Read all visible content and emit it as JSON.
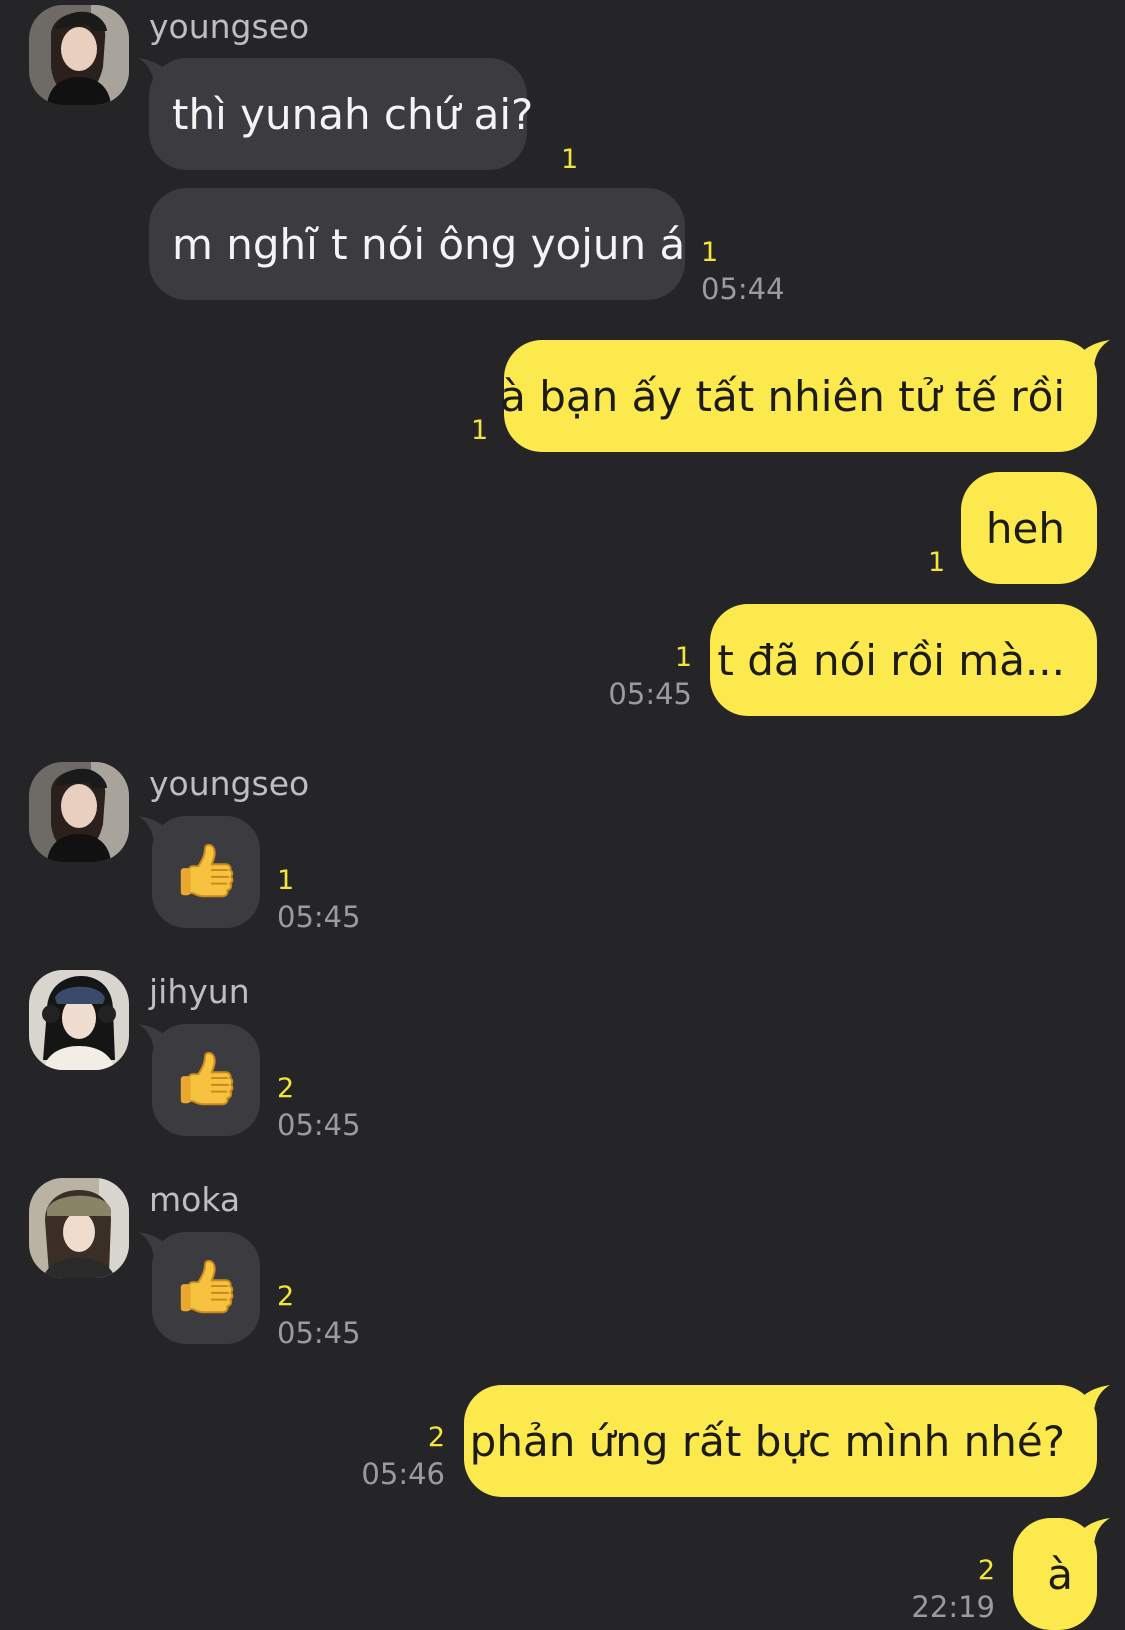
{
  "colors": {
    "background": "#252528",
    "incoming_bubble": "#3c3c40",
    "outgoing_bubble": "#fbe94e",
    "unread_count": "#f4e43e",
    "timestamp": "#9a9aa0",
    "sender_name": "#bdbdc2"
  },
  "messages": [
    {
      "sender": "youngseo",
      "avatar": "avatar-photo-icon",
      "text": "thì yunah chứ ai?",
      "unread": "1"
    },
    {
      "text": "m nghĩ t nói ông yojun á",
      "unread": "1",
      "time": "05:44"
    },
    {
      "text": "à bạn ấy tất nhiên tử tế rồi",
      "unread": "1"
    },
    {
      "text": "heh",
      "unread": "1"
    },
    {
      "text": "t đã nói rồi mà...",
      "unread": "1",
      "time": "05:45"
    },
    {
      "sender": "youngseo",
      "avatar": "avatar-photo-icon",
      "emoji": "thumbs-up-icon",
      "unread": "1",
      "time": "05:45"
    },
    {
      "sender": "jihyun",
      "avatar": "avatar-photo-icon",
      "emoji": "thumbs-up-icon",
      "unread": "2",
      "time": "05:45"
    },
    {
      "sender": "moka",
      "avatar": "avatar-photo-icon",
      "emoji": "thumbs-up-icon",
      "unread": "2",
      "time": "05:45"
    },
    {
      "text": "phản ứng rất bực mình nhé?",
      "unread": "2",
      "time": "05:46"
    },
    {
      "text": "à",
      "unread": "2",
      "time": "22:19"
    }
  ]
}
